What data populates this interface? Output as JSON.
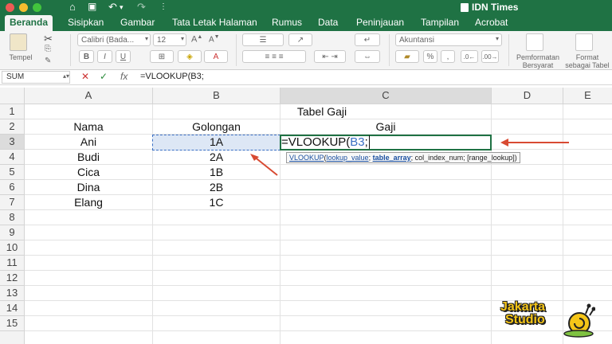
{
  "app": {
    "window_title": "IDN Times"
  },
  "tabs": [
    "Beranda",
    "Sisipkan",
    "Gambar",
    "Tata Letak Halaman",
    "Rumus",
    "Data",
    "Peninjauan",
    "Tampilan",
    "Acrobat"
  ],
  "ribbon": {
    "paste_label": "Tempel",
    "font_name": "Calibri (Bada...",
    "font_size": "12",
    "number_format": "Akuntansi",
    "conditional_format_label": "Pemformatan Bersyarat",
    "format_table_label": "Format sebagai Tabel",
    "bold": "B",
    "italic": "I",
    "underline": "U",
    "percent": "%"
  },
  "formula_bar": {
    "name_box": "SUM",
    "cancel_icon": "✕",
    "enter_icon": "✓",
    "fx_label": "fx",
    "content": "=VLOOKUP(B3;"
  },
  "grid": {
    "columns": [
      "A",
      "B",
      "C",
      "D",
      "E"
    ],
    "rows": [
      "1",
      "2",
      "3",
      "4",
      "5",
      "6",
      "7",
      "8",
      "9",
      "10",
      "11",
      "12",
      "13",
      "14",
      "15"
    ],
    "title": "Tabel Gaji",
    "headers": [
      "Nama",
      "Golongan",
      "Gaji"
    ],
    "data": [
      [
        "Ani",
        "1A"
      ],
      [
        "Budi",
        "2A"
      ],
      [
        "Cica",
        "1B"
      ],
      [
        "Dina",
        "2B"
      ],
      [
        "Elang",
        "1C"
      ]
    ]
  },
  "editing": {
    "formula_prefix": "=VLOOKUP(",
    "formula_ref": "B3",
    "formula_suffix": ";",
    "tooltip_fn": "VLOOKUP",
    "tooltip_arg1": "lookup_value",
    "tooltip_arg2": "table_array",
    "tooltip_rest": "; col_index_num; [range_lookup])"
  },
  "watermark": {
    "line1": "Jakarta",
    "line2": "Studio"
  },
  "colors": {
    "excel_green": "#1f7244",
    "selection": "#dde7f5",
    "arrow": "#d84a32"
  }
}
